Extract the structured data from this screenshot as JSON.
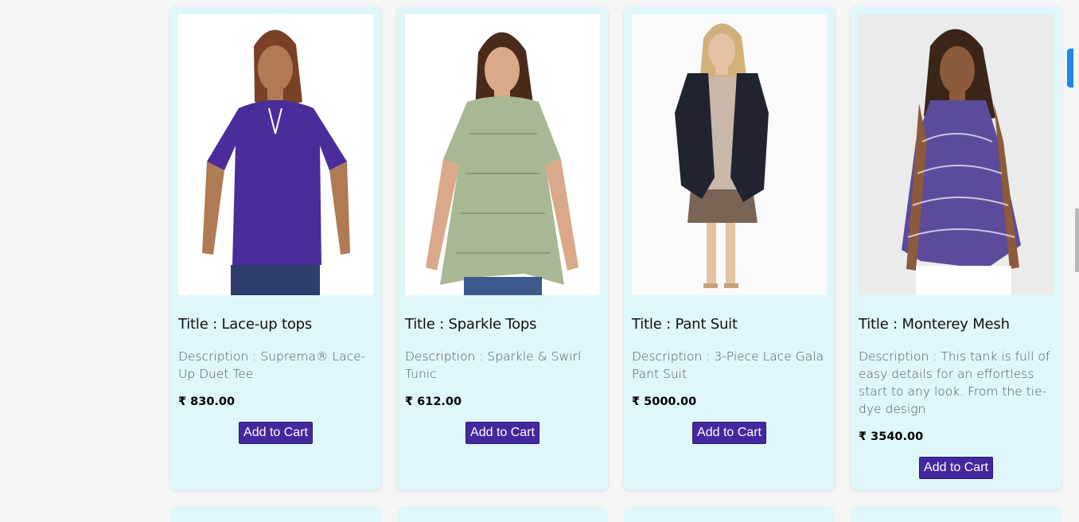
{
  "products": [
    {
      "title": "Title : Lace-up tops",
      "description": "Description : Suprema® Lace-Up Duet Tee",
      "price": "₹ 830.00",
      "button_label": "Add to Cart",
      "shirt_color": "#4a2c9a"
    },
    {
      "title": "Title : Sparkle Tops",
      "description": "Description : Sparkle & Swirl Tunic",
      "price": "₹ 612.00",
      "button_label": "Add to Cart",
      "shirt_color": "#a9b894"
    },
    {
      "title": "Title : Pant Suit",
      "description": "Description : 3-Piece Lace Gala Pant Suit",
      "price": "₹ 5000.00",
      "button_label": "Add to Cart",
      "shirt_color": "#1f2430"
    },
    {
      "title": "Title : Monterey Mesh",
      "description": "Description : This tank is full of easy details for an effortless start to any look. From the tie-dye design",
      "price": "₹ 3540.00",
      "button_label": "Add to Cart",
      "shirt_color": "#5b4b9a"
    }
  ],
  "colors": {
    "card_bg": "#e0f7fa",
    "button_bg": "#4527a0",
    "page_bg": "#f5f5f5"
  }
}
